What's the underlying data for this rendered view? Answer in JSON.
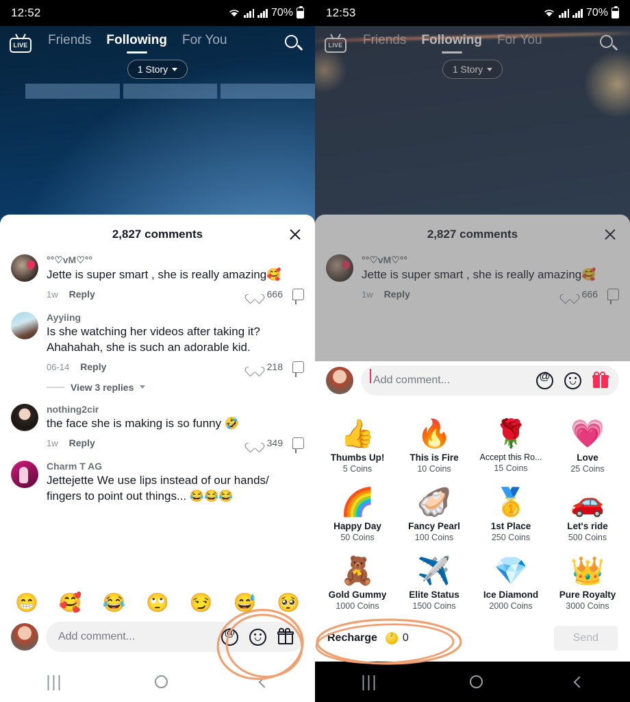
{
  "left_panel": {
    "status_bar": {
      "time": "12:52",
      "battery_percent": "70%"
    },
    "top_nav": {
      "live_label": "LIVE",
      "tabs": [
        {
          "label": "Friends",
          "active": false
        },
        {
          "label": "Following",
          "active": true
        },
        {
          "label": "For You",
          "active": false
        }
      ],
      "search_icon": "search-icon",
      "story_chip": "1 Story"
    },
    "comment_sheet": {
      "title": "2,827 comments",
      "close_icon": "close-icon",
      "comments": [
        {
          "username": "°°♡vM♡°°",
          "text": "Jette is super smart , she is really amazing🥰",
          "date": "1w",
          "reply": "Reply",
          "likes": "666"
        },
        {
          "username": "Ayyiing",
          "text": "Is she watching her videos after taking it? Ahahahah, she is such an adorable kid.",
          "date": "06-14",
          "reply": "Reply",
          "likes": "218",
          "view_replies": "View 3 replies"
        },
        {
          "username": "nothing2cir",
          "text": "the face she is making is so funny 🤣",
          "date": "1w",
          "reply": "Reply",
          "likes": "349"
        },
        {
          "username": "Charm T AG",
          "text": "Jettejette We use lips instead of our hands/ fingers to point out things... 😂😂😂",
          "date": "",
          "reply": "",
          "likes": ""
        }
      ],
      "quick_emojis": [
        "😁",
        "🥰",
        "😂",
        "🙄",
        "😏",
        "😅",
        "🥺"
      ],
      "input": {
        "placeholder": "Add comment...",
        "at_icon": "at-mention-icon",
        "emoji_icon": "emoji-face-icon",
        "gift_icon": "gift-icon"
      }
    },
    "nav_bar": {
      "recent": "|||",
      "home": "home-icon",
      "back": "back-icon"
    }
  },
  "right_panel": {
    "status_bar": {
      "time": "12:53",
      "battery_percent": "70%"
    },
    "top_nav": {
      "live_label": "LIVE",
      "tabs": [
        {
          "label": "Friends",
          "active": false
        },
        {
          "label": "Following",
          "active": true
        },
        {
          "label": "For You",
          "active": false
        }
      ],
      "search_icon": "search-icon",
      "story_chip": "1 Story"
    },
    "comment_sheet": {
      "title": "2,827 comments",
      "close_icon": "close-icon",
      "comments": [
        {
          "username": "°°♡vM♡°°",
          "text": "Jette is super smart , she is really amazing🥰",
          "date": "1w",
          "reply": "Reply",
          "likes": "666"
        }
      ]
    },
    "gift_panel": {
      "input": {
        "placeholder": "Add comment...",
        "at_icon": "at-mention-icon",
        "emoji_icon": "emoji-face-icon",
        "gift_icon": "gift-icon-active"
      },
      "gifts": [
        {
          "emoji": "👍",
          "name": "Thumbs Up!",
          "coins": "5 Coins",
          "truncated": false
        },
        {
          "emoji": "🔥",
          "name": "This is Fire",
          "coins": "10 Coins",
          "truncated": false
        },
        {
          "emoji": "🌹",
          "name": "Accept this Ro...",
          "coins": "15 Coins",
          "truncated": true
        },
        {
          "emoji": "💗",
          "name": "Love",
          "coins": "25 Coins",
          "truncated": false
        },
        {
          "emoji": "🌈",
          "name": "Happy Day",
          "coins": "50 Coins",
          "truncated": false
        },
        {
          "emoji": "🦪",
          "name": "Fancy Pearl",
          "coins": "100 Coins",
          "truncated": false
        },
        {
          "emoji": "🥇",
          "name": "1st Place",
          "coins": "250 Coins",
          "truncated": false
        },
        {
          "emoji": "🚗",
          "name": "Let's ride",
          "coins": "500 Coins",
          "truncated": false
        },
        {
          "emoji": "🧸",
          "name": "Gold Gummy",
          "coins": "1000 Coins",
          "truncated": false
        },
        {
          "emoji": "✈️",
          "name": "Elite Status",
          "coins": "1500 Coins",
          "truncated": false
        },
        {
          "emoji": "💎",
          "name": "Ice Diamond",
          "coins": "2000 Coins",
          "truncated": false
        },
        {
          "emoji": "👑",
          "name": "Pure Royalty",
          "coins": "3000 Coins",
          "truncated": false
        }
      ],
      "recharge": {
        "label": "Recharge",
        "coin_icon": "coin-icon",
        "balance": "0"
      },
      "send_button": "Send"
    },
    "nav_bar": {
      "recent": "|||",
      "home": "home-icon",
      "back": "back-icon"
    }
  },
  "annotations": {
    "color": "#f0a070",
    "items": [
      {
        "name": "gift-icon-highlight-circle",
        "target": "left gift icon in comment bar"
      },
      {
        "name": "recharge-highlight-circle",
        "target": "right recharge balance"
      }
    ]
  }
}
